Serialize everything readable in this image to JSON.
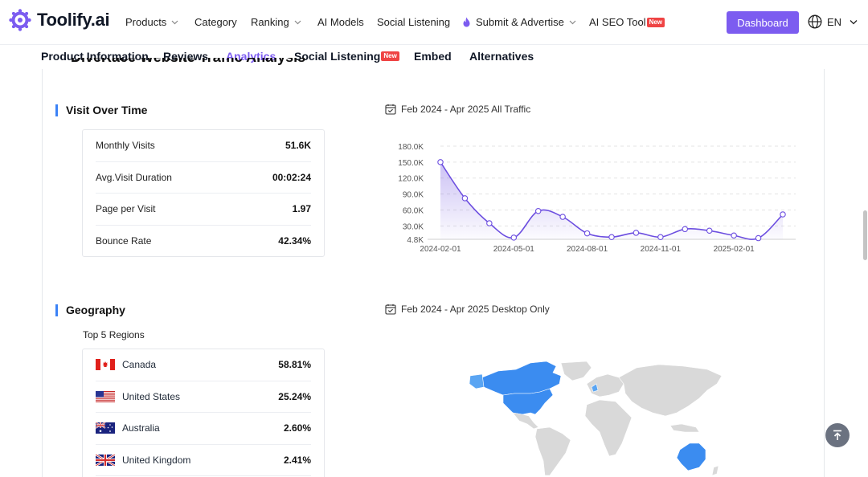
{
  "header": {
    "logo_text": "Toolify.ai",
    "nav": [
      {
        "label": "Products",
        "dropdown": true
      },
      {
        "label": "Category",
        "dropdown": false
      },
      {
        "label": "Ranking",
        "dropdown": true
      },
      {
        "label": "AI Models",
        "dropdown": false
      },
      {
        "label": "Social Listening",
        "dropdown": false
      },
      {
        "label": "Submit & Advertise",
        "dropdown": true
      },
      {
        "label": "AI SEO Tool",
        "badge": "New"
      }
    ],
    "dashboard_label": "Dashboard",
    "language": "EN"
  },
  "tabs": [
    {
      "label": "Product Information"
    },
    {
      "label": "Reviews"
    },
    {
      "label": "Analytics",
      "active": true
    },
    {
      "label": "Social Listening",
      "badge": "New"
    },
    {
      "label": "Embed"
    },
    {
      "label": "Alternatives"
    }
  ],
  "section_heading_cut": "DiveRace Website Traffic Analysis",
  "visits": {
    "title": "Visit Over Time",
    "date_range": "Feb 2024 - Apr 2025 All Traffic",
    "stats": [
      {
        "label": "Monthly Visits",
        "value": "51.6K"
      },
      {
        "label": "Avg.Visit Duration",
        "value": "00:02:24"
      },
      {
        "label": "Page per Visit",
        "value": "1.97"
      },
      {
        "label": "Bounce Rate",
        "value": "42.34%"
      }
    ]
  },
  "chart_data": {
    "type": "area",
    "x": [
      "2024-02-01",
      "2024-03-01",
      "2024-04-01",
      "2024-05-01",
      "2024-06-01",
      "2024-07-01",
      "2024-08-01",
      "2024-09-01",
      "2024-10-01",
      "2024-11-01",
      "2024-12-01",
      "2025-01-01",
      "2025-02-01",
      "2025-03-01",
      "2025-04-01"
    ],
    "xticks": [
      "2024-02-01",
      "2024-05-01",
      "2024-08-01",
      "2024-11-01",
      "2025-02-01"
    ],
    "series": [
      {
        "values": [
          150000,
          82000,
          35000,
          8000,
          58000,
          47000,
          16000,
          9000,
          17000,
          9000,
          24000,
          21000,
          12000,
          7000,
          51600
        ]
      }
    ],
    "yticks": [
      "4.8K",
      "30.0K",
      "60.0K",
      "90.0K",
      "120.0K",
      "150.0K",
      "180.0K"
    ],
    "ylim": [
      4800,
      180000
    ],
    "grid": true,
    "color": "#6c4ee0"
  },
  "geography": {
    "title": "Geography",
    "date_range": "Feb 2024 - Apr 2025 Desktop Only",
    "top_label": "Top 5 Regions",
    "regions": [
      {
        "country": "Canada",
        "flag": "canada-flag",
        "value": "58.81%"
      },
      {
        "country": "United States",
        "flag": "us-flag",
        "value": "25.24%"
      },
      {
        "country": "Australia",
        "flag": "australia-flag",
        "value": "2.60%"
      },
      {
        "country": "United Kingdom",
        "flag": "uk-flag",
        "value": "2.41%"
      }
    ]
  },
  "colors": {
    "accent": "#7c5cf0",
    "section_bar": "#3b82f6",
    "map_high": "#3b8cf0",
    "map_mid": "#5aa5f3",
    "map_low": "#d9d9d9"
  }
}
